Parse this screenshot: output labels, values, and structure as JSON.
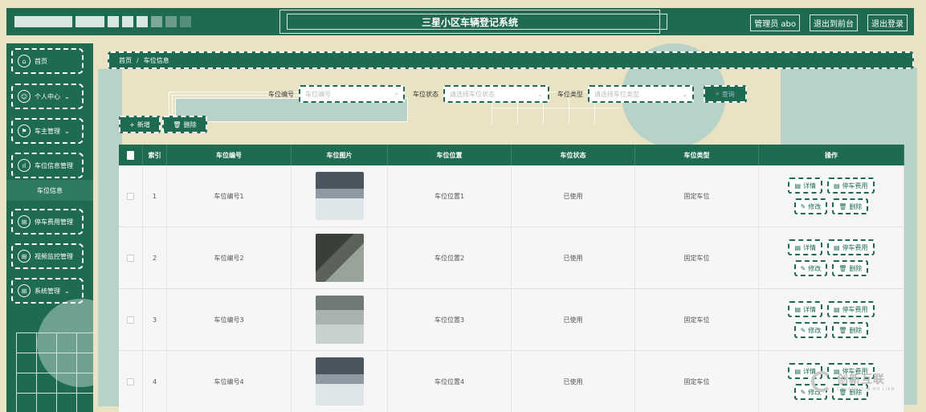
{
  "header": {
    "title": "三星小区车辆登记系统",
    "admin": "管理员 abo",
    "back_front": "退出到前台",
    "logout": "退出登录"
  },
  "sidebar": {
    "items": [
      {
        "label": "首页",
        "icon": "home-icon"
      },
      {
        "label": "个人中心",
        "icon": "user-icon"
      },
      {
        "label": "车主管理",
        "icon": "flag-icon"
      },
      {
        "label": "车位信息管理",
        "icon": "chart-icon"
      },
      {
        "label": "停车费用管理",
        "icon": "grid-icon"
      },
      {
        "label": "视频监控管理",
        "icon": "grid-icon"
      },
      {
        "label": "系统管理",
        "icon": "grid-icon"
      }
    ],
    "active_sub": "车位信息"
  },
  "breadcrumb": {
    "home": "首页",
    "sep": "/",
    "current": "车位信息"
  },
  "search": {
    "code_label": "车位编号",
    "code_placeholder": "车位编号",
    "status_label": "车位状态",
    "status_placeholder": "请选择车位状态",
    "type_label": "车位类型",
    "type_placeholder": "请选择车位类型",
    "query": "查询"
  },
  "actions": {
    "add": "新增",
    "delete": "删除"
  },
  "table": {
    "headers": [
      "索引",
      "车位编号",
      "车位图片",
      "车位位置",
      "车位状态",
      "车位类型",
      "操作"
    ],
    "rows": [
      {
        "index": "1",
        "code": "车位编号1",
        "location": "车位位置1",
        "status": "已使用",
        "type": "固定车位"
      },
      {
        "index": "2",
        "code": "车位编号2",
        "location": "车位位置2",
        "status": "已使用",
        "type": "固定车位"
      },
      {
        "index": "3",
        "code": "车位编号3",
        "location": "车位位置3",
        "status": "已使用",
        "type": "固定车位"
      },
      {
        "index": "4",
        "code": "车位编号4",
        "location": "车位位置4",
        "status": "已使用",
        "type": "固定车位"
      }
    ],
    "ops": {
      "detail": "详情",
      "fee": "停车费用",
      "edit": "修改",
      "delete": "删除"
    }
  },
  "watermark": {
    "name": "创新互联",
    "sub": "CHUANG XIN HU LIAN"
  },
  "colors": {
    "primary": "#1e6b51",
    "background": "#e9e3c4",
    "accent_light": "#b9d2c8"
  }
}
